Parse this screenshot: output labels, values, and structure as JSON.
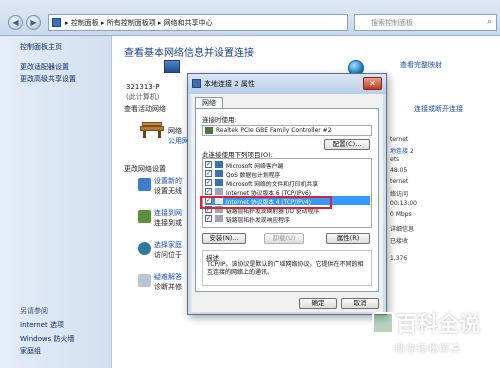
{
  "address_bar": {
    "crumbs": "▸ 控制面板 ▸ 所有控制面板项 ▸ 网络和共享中心",
    "search_placeholder": "搜索控制面板"
  },
  "left_pane": {
    "items": [
      "控制面板主页",
      "更改适配器设置",
      "更改高级共享设置"
    ],
    "see_also_title": "另请参阅",
    "see_also": [
      "Internet 选项",
      "Windows 防火墙",
      "家庭组"
    ]
  },
  "main": {
    "title": "查看基本网络信息并设置连接",
    "full_map_link": "查看完整映射",
    "computer_label": "321313-P",
    "this_computer": "(此计算机)",
    "active_networks": "查看活动网络",
    "network_label": "网络",
    "network_sub": "公用网",
    "connect_disconnect": "连接或断开连接",
    "change_settings": "更改网络设置",
    "tasks": [
      {
        "title": "设置新的",
        "sub": "设置无线"
      },
      {
        "title": "连接到网",
        "sub": "连接到或"
      },
      {
        "title": "选择家庭",
        "sub": "访问位于"
      },
      {
        "title": "疑难解答",
        "sub": "诊断并修"
      }
    ],
    "right_values": [
      "ternet",
      "地连接 2",
      "ets",
      "48:05",
      "ternet",
      "络访问",
      "00:13:00",
      "0 Mbps",
      "详细信息",
      "已接收",
      "1,376"
    ]
  },
  "dialog": {
    "title": "本地连接 2 属性",
    "tab": "网络",
    "connect_using": "连接时使用:",
    "adapter": "Realtek PCIe GBE Family Controller #2",
    "configure": "配置(C)...",
    "items_label": "此连接使用下列项目(O):",
    "items": [
      {
        "text": "Microsoft 网络客户端",
        "checked": true
      },
      {
        "text": "QoS 数据包计划程序",
        "checked": true
      },
      {
        "text": "Microsoft 网络的文件和打印机共享",
        "checked": true
      },
      {
        "text": "Internet 协议版本 6 (TCP/IPv6)",
        "checked": true
      },
      {
        "text": "Internet 协议版本 4 (TCP/IPv4)",
        "checked": true
      },
      {
        "text": "链路层拓扑发现映射器 I/O 驱动程序",
        "checked": true
      },
      {
        "text": "链路层拓扑发现响应程序",
        "checked": true
      }
    ],
    "install": "安装(N)...",
    "uninstall": "卸载(U)",
    "properties": "属性(R)",
    "description_title": "描述",
    "description": "TCP/IP。该协议是默认的广域网络协议，它提供在不同的相互连接的网络上的通讯。",
    "ok": "确定",
    "cancel": "取消"
  },
  "watermark": {
    "title": "百科全说",
    "subtitle": "助你轻松解决"
  },
  "colors": {
    "accent_link": "#1a4fb5",
    "highlight_box": "#e0203a",
    "selected_row": "#3399ff"
  }
}
